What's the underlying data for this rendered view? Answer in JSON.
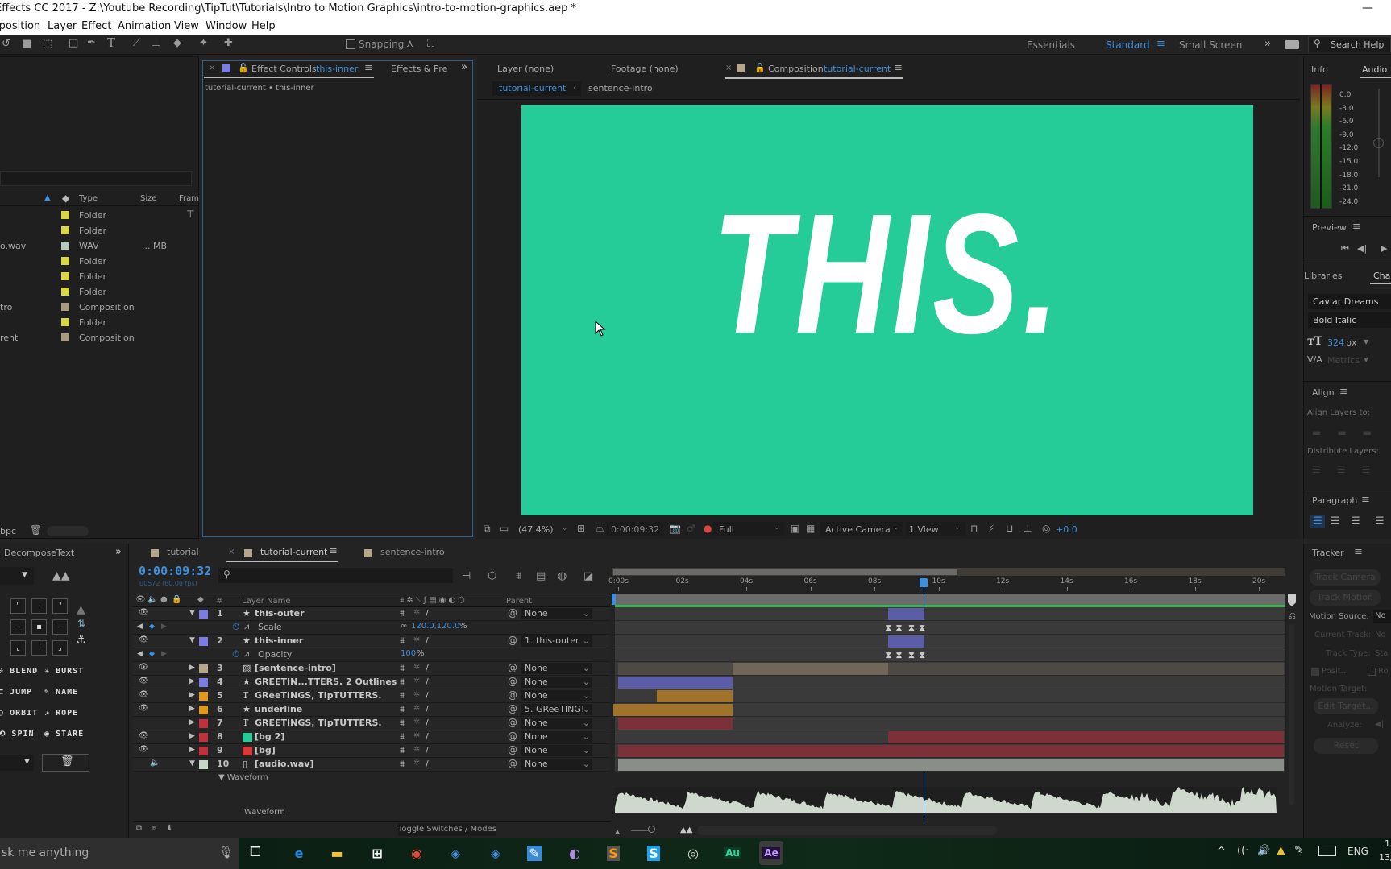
{
  "window": {
    "title": "Effects CC 2017 - Z:\\Youtube Recording\\TipTut\\Tutorials\\Intro to Motion Graphics\\intro-to-motion-graphics.aep *"
  },
  "menu": [
    "mposition",
    "Layer",
    "Effect",
    "Animation",
    "View",
    "Window",
    "Help"
  ],
  "toolbar": {
    "snapping": "Snapping",
    "workspaces": [
      "Essentials",
      "Standard",
      "Small Screen"
    ],
    "active_workspace": "Standard",
    "search_help": "Search Help"
  },
  "project": {
    "columns": {
      "type": "Type",
      "size": "Size",
      "frame": "Fram"
    },
    "items": [
      {
        "name": "",
        "type": "Folder",
        "size": "",
        "color": "#d8d846"
      },
      {
        "name": "",
        "type": "Folder",
        "size": "",
        "color": "#d8d846"
      },
      {
        "name": "o.wav",
        "type": "WAV",
        "size": "... MB",
        "color": "#b8c9c0"
      },
      {
        "name": "",
        "type": "Folder",
        "size": "",
        "color": "#d8d846"
      },
      {
        "name": "",
        "type": "Folder",
        "size": "",
        "color": "#d8d846"
      },
      {
        "name": "",
        "type": "Folder",
        "size": "",
        "color": "#d8d846"
      },
      {
        "name": "tro",
        "type": "Composition",
        "size": "",
        "color": "#a89c80"
      },
      {
        "name": "",
        "type": "Folder",
        "size": "",
        "color": "#d8d846"
      },
      {
        "name": "rent",
        "type": "Composition",
        "size": "",
        "color": "#a89c80"
      }
    ],
    "bpc": "bpc"
  },
  "effect_controls": {
    "tab_prefix": "Effect Controls",
    "layer": "this-inner",
    "other_tab": "Effects & Pre",
    "subtitle": "tutorial-current • this-inner"
  },
  "viewer": {
    "tabs": {
      "layer": "Layer (none)",
      "footage": "Footage (none)",
      "comp_prefix": "Composition",
      "comp": "tutorial-current"
    },
    "flow": [
      "tutorial-current",
      "sentence-intro"
    ],
    "comp_text": "THIS.",
    "comp_bg": "#26cc98",
    "zoom": "(47.4%)",
    "timecode": "0:00:09:32",
    "resolution": "Full",
    "camera": "Active Camera",
    "views": "1 View",
    "exposure": "+0.0"
  },
  "right": {
    "info": "Info",
    "audio": "Audio",
    "meter_labels": [
      "0.0",
      "-3.0",
      "-6.0",
      "-9.0",
      "-12.0",
      "-15.0",
      "-18.0",
      "-21.0",
      "-24.0"
    ],
    "preview": "Preview",
    "libraries": "Libraries",
    "character": "Char",
    "font": "Caviar Dreams",
    "style": "Bold Italic",
    "size_value": "324",
    "size_unit": "px",
    "kerning": "Metrics",
    "align": "Align",
    "align_to": "Align Layers to:",
    "distribute": "Distribute Layers:",
    "paragraph": "Paragraph"
  },
  "tracker": {
    "title": "Tracker",
    "track_camera": "Track Camera",
    "track_motion": "Track Motion",
    "motion_source": "Motion Source:",
    "motion_source_value": "No",
    "current_track": "Current Track:",
    "current_track_value": "No",
    "track_type": "Track Type:",
    "track_type_value": "Sta",
    "position": "Posit...",
    "rotation": "Ro",
    "motion_target": "Motion Target:",
    "edit_target": "Edit Target...",
    "analyze": "Analyze:",
    "reset": "Reset"
  },
  "decompose": {
    "title": "DecomposeText",
    "buttons": [
      "BLEND",
      "BURST",
      "JUMP",
      "NAME",
      "ORBIT",
      "ROPE",
      "SPIN",
      "STARE"
    ]
  },
  "timeline": {
    "tabs": [
      {
        "label": "tutorial",
        "color": "#b3a68a"
      },
      {
        "label": "tutorial-current",
        "color": "#b3a68a"
      },
      {
        "label": "sentence-intro",
        "color": "#b3a68a"
      }
    ],
    "active_tab": "tutorial-current",
    "timecode": "0:00:09:32",
    "frame_info": "00572 (60.00 fps)",
    "header": {
      "num": "#",
      "layer_name": "Layer Name",
      "parent": "Parent"
    },
    "ruler": [
      "0:00s",
      "02s",
      "04s",
      "06s",
      "08s",
      "10s",
      "12s",
      "14s",
      "16s",
      "18s",
      "20s"
    ],
    "duration_s": 20.77,
    "playhead_s": 9.533,
    "work_area_end_s": 20.77,
    "rows": [
      {
        "kind": "layer",
        "num": "1",
        "name": "this-outer",
        "icon": "star",
        "color": "#7b7de0",
        "expanded": true,
        "visible": true,
        "parent": "None",
        "bars": [
          {
            "in": 8.44,
            "out": 9.55,
            "color": "#5b5ea6"
          }
        ]
      },
      {
        "kind": "prop",
        "name": "Scale",
        "value": "120.0,120.0",
        "unit": "%",
        "linked": true,
        "keys": [
          8.44,
          8.77,
          9.16,
          9.49
        ]
      },
      {
        "kind": "layer",
        "num": "2",
        "name": "this-inner",
        "icon": "star",
        "color": "#7b7de0",
        "expanded": true,
        "visible": true,
        "parent": "1. this-outer",
        "bars": [
          {
            "in": 8.44,
            "out": 9.55,
            "color": "#5b5ea6"
          }
        ]
      },
      {
        "kind": "prop",
        "name": "Opacity",
        "value": "100",
        "unit": "%",
        "keys": [
          8.44,
          8.77,
          9.16,
          9.49
        ]
      },
      {
        "kind": "layer",
        "num": "3",
        "name": "[sentence-intro]",
        "icon": "comp",
        "color": "#b3a68a",
        "visible": true,
        "parent": "None",
        "bars": [
          {
            "in": 0,
            "out": 20.77,
            "color": "#4d4a45"
          },
          {
            "in": 3.57,
            "out": 8.44,
            "color": "#706758"
          }
        ]
      },
      {
        "kind": "layer",
        "num": "4",
        "name": "GREETIN...TTERS. 2 Outlines",
        "icon": "star",
        "color": "#7b7de0",
        "visible": true,
        "parent": "None",
        "bars": [
          {
            "in": 0,
            "out": 3.57,
            "color": "#5b5ea6"
          }
        ]
      },
      {
        "kind": "layer",
        "num": "5",
        "name": "GReeTINGS, TIpTUTTERS.",
        "icon": "text",
        "color": "#e09a20",
        "visible": true,
        "parent": "None",
        "bars": [
          {
            "in": 1.22,
            "out": 3.57,
            "color": "#a0722a"
          }
        ]
      },
      {
        "kind": "layer",
        "num": "6",
        "name": "underline",
        "icon": "star",
        "color": "#e09a20",
        "visible": true,
        "parent": "5. GReeTING!",
        "bars": [
          {
            "in": -0.15,
            "out": 3.57,
            "color": "#a0722a"
          }
        ]
      },
      {
        "kind": "layer",
        "num": "7",
        "name": "GREETINGS, TIpTUTTERS.",
        "icon": "text",
        "color": "#c0303e",
        "visible": false,
        "parent": "None",
        "bars": [
          {
            "in": 0,
            "out": 3.57,
            "color": "#7c3038"
          }
        ]
      },
      {
        "kind": "layer",
        "num": "8",
        "name": "[bg 2]",
        "icon": "solid-green",
        "color": "#c0303e",
        "visible": true,
        "parent": "None",
        "bars": [
          {
            "in": 8.44,
            "out": 20.77,
            "color": "#7c3038"
          }
        ]
      },
      {
        "kind": "layer",
        "num": "9",
        "name": "[bg]",
        "icon": "solid-red",
        "color": "#c0303e",
        "visible": true,
        "parent": "None",
        "bars": [
          {
            "in": 0,
            "out": 20.77,
            "color": "#7c3038"
          }
        ]
      },
      {
        "kind": "layer",
        "num": "10",
        "name": "[audio.wav]",
        "icon": "audio",
        "color": "#c5d6c5",
        "expanded": true,
        "audio": true,
        "parent": "None",
        "bars": [
          {
            "in": 0,
            "out": 20.77,
            "color": "#8a8e88"
          }
        ]
      }
    ],
    "waveform_group": "Waveform",
    "waveform_label": "Waveform",
    "toggle": "Toggle Switches / Modes"
  },
  "taskbar": {
    "search": "sk me anything",
    "apps": [
      "edge",
      "file-explorer",
      "store",
      "chrome",
      "app",
      "app",
      "pen",
      "torrent",
      "sublime",
      "skype",
      "obs",
      "Au",
      "Ae"
    ],
    "lang": "ENG",
    "time": "1",
    "date": "13/"
  }
}
